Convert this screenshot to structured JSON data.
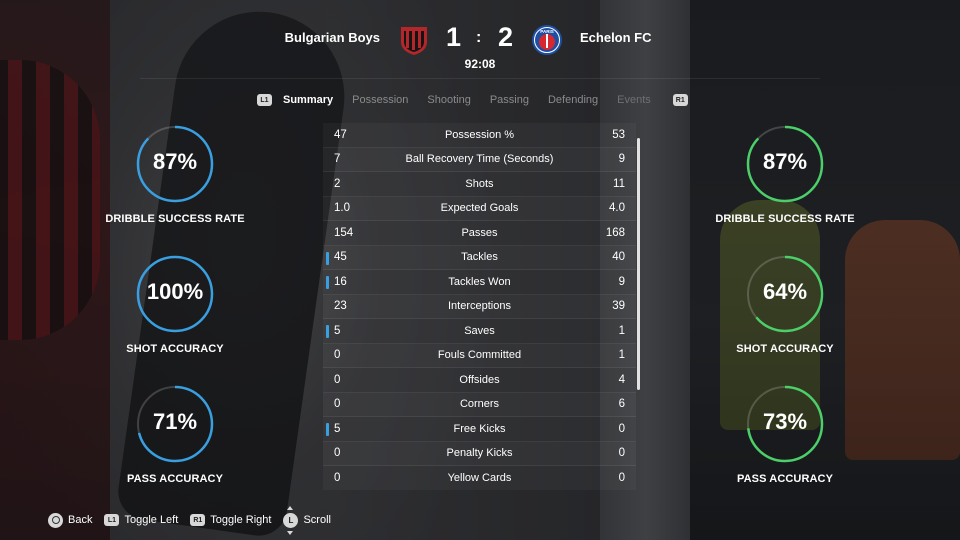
{
  "match": {
    "home_team": "Bulgarian Boys",
    "away_team": "Echelon FC",
    "home_score": "1",
    "away_score": "2",
    "separator": ":",
    "clock": "92:08",
    "crest_away_text": "PARIS"
  },
  "tabs": {
    "left_button": "L1",
    "right_button": "R1",
    "items": [
      {
        "label": "Summary",
        "active": true
      },
      {
        "label": "Possession"
      },
      {
        "label": "Shooting"
      },
      {
        "label": "Passing"
      },
      {
        "label": "Defending"
      },
      {
        "label": "Events"
      }
    ]
  },
  "gauges": {
    "home": [
      {
        "value": "87%",
        "fraction": 0.87,
        "label": "DRIBBLE SUCCESS RATE"
      },
      {
        "value": "100%",
        "fraction": 1.0,
        "label": "SHOT ACCURACY"
      },
      {
        "value": "71%",
        "fraction": 0.71,
        "label": "PASS ACCURACY"
      }
    ],
    "away": [
      {
        "value": "87%",
        "fraction": 0.87,
        "label": "DRIBBLE SUCCESS RATE"
      },
      {
        "value": "64%",
        "fraction": 0.64,
        "label": "SHOT ACCURACY"
      },
      {
        "value": "73%",
        "fraction": 0.73,
        "label": "PASS ACCURACY"
      }
    ]
  },
  "stats": [
    {
      "label": "Possession %",
      "home": "47",
      "away": "53",
      "leader": "away"
    },
    {
      "label": "Ball Recovery Time (Seconds)",
      "home": "7",
      "away": "9",
      "leader": "away"
    },
    {
      "label": "Shots",
      "home": "2",
      "away": "11",
      "leader": "away"
    },
    {
      "label": "Expected Goals",
      "home": "1.0",
      "away": "4.0",
      "leader": "away"
    },
    {
      "label": "Passes",
      "home": "154",
      "away": "168",
      "leader": "away"
    },
    {
      "label": "Tackles",
      "home": "45",
      "away": "40",
      "leader": "home"
    },
    {
      "label": "Tackles Won",
      "home": "16",
      "away": "9",
      "leader": "home"
    },
    {
      "label": "Interceptions",
      "home": "23",
      "away": "39",
      "leader": "away"
    },
    {
      "label": "Saves",
      "home": "5",
      "away": "1",
      "leader": "home"
    },
    {
      "label": "Fouls Committed",
      "home": "0",
      "away": "1",
      "leader": "away"
    },
    {
      "label": "Offsides",
      "home": "0",
      "away": "4",
      "leader": "away"
    },
    {
      "label": "Corners",
      "home": "0",
      "away": "6",
      "leader": "away"
    },
    {
      "label": "Free Kicks",
      "home": "5",
      "away": "0",
      "leader": "home"
    },
    {
      "label": "Penalty Kicks",
      "home": "0",
      "away": "0",
      "leader": "none"
    },
    {
      "label": "Yellow Cards",
      "home": "0",
      "away": "0",
      "leader": "none"
    }
  ],
  "footer": {
    "back_label": "Back",
    "toggle_left_label": "Toggle Left",
    "toggle_left_button": "L1",
    "toggle_right_label": "Toggle Right",
    "toggle_right_button": "R1",
    "scroll_label": "Scroll",
    "scroll_button": "L"
  },
  "colors": {
    "home_accent": "#3a9fe0",
    "away_accent": "#4ccf6a",
    "home_crest": "#b3262a",
    "away_crest": "#1f4fa3"
  }
}
